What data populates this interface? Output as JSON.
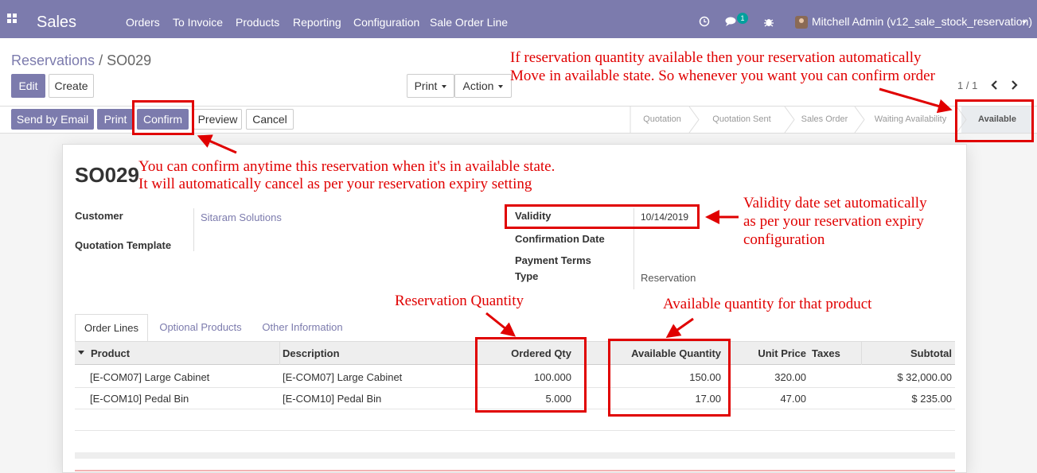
{
  "navbar": {
    "app_name": "Sales",
    "menu": [
      "Orders",
      "To Invoice",
      "Products",
      "Reporting",
      "Configuration",
      "Sale Order Line"
    ],
    "chat_count": "1",
    "user": "Mitchell Admin (v12_sale_stock_reservation)",
    "icons": [
      "apps-grid-icon",
      "clock-icon",
      "chat-icon",
      "bug-icon",
      "avatar",
      "chevron-down-icon"
    ]
  },
  "breadcrumb": {
    "parent": "Reservations",
    "separator": "/",
    "current": "SO029"
  },
  "control": {
    "edit": "Edit",
    "create": "Create",
    "print": "Print",
    "action": "Action",
    "pager": "1 / 1"
  },
  "statusbar": {
    "buttons": [
      "Send by Email",
      "Print",
      "Confirm",
      "Preview",
      "Cancel"
    ],
    "stages": [
      "Quotation",
      "Quotation Sent",
      "Sales Order",
      "Waiting Availability",
      "Available"
    ],
    "active_stage": "Available"
  },
  "form": {
    "title": "SO029",
    "customer_label": "Customer",
    "customer_value": "Sitaram Solutions",
    "template_label": "Quotation Template",
    "validity_label": "Validity",
    "validity_value": "10/14/2019",
    "confirmation_label": "Confirmation Date",
    "payment_terms_label": "Payment Terms",
    "type_label": "Type",
    "type_value": "Reservation"
  },
  "tabs": [
    "Order Lines",
    "Optional Products",
    "Other Information"
  ],
  "table": {
    "headers": [
      "Product",
      "Description",
      "Ordered Qty",
      "Available Quantity",
      "Unit Price",
      "Taxes",
      "Subtotal"
    ],
    "rows": [
      {
        "product": "[E-COM07] Large Cabinet",
        "description": "[E-COM07] Large Cabinet",
        "ordered": "100.000",
        "available": "150.00",
        "price": "320.00",
        "taxes": "",
        "subtotal": "$ 32,000.00"
      },
      {
        "product": "[E-COM10] Pedal Bin",
        "description": "[E-COM10] Pedal Bin",
        "ordered": "5.000",
        "available": "17.00",
        "price": "47.00",
        "taxes": "",
        "subtotal": "$ 235.00"
      }
    ]
  },
  "annotations": {
    "available_state_1": "If reservation quantity available then your reservation automatically",
    "available_state_2": "Move in available state. So whenever you want you can confirm order",
    "confirm_1": "You can confirm anytime this reservation when it's in available state.",
    "confirm_2": "It will automatically cancel as per your reservation expiry setting",
    "validity_1": "Validity date set automatically",
    "validity_2": "as per your reservation expiry",
    "validity_3": "configuration",
    "reservation_qty": "Reservation Quantity",
    "available_qty": "Available quantity for that product"
  },
  "colors": {
    "brand": "#7c7bad",
    "annotation": "#e00000",
    "badge": "#00a09d"
  }
}
